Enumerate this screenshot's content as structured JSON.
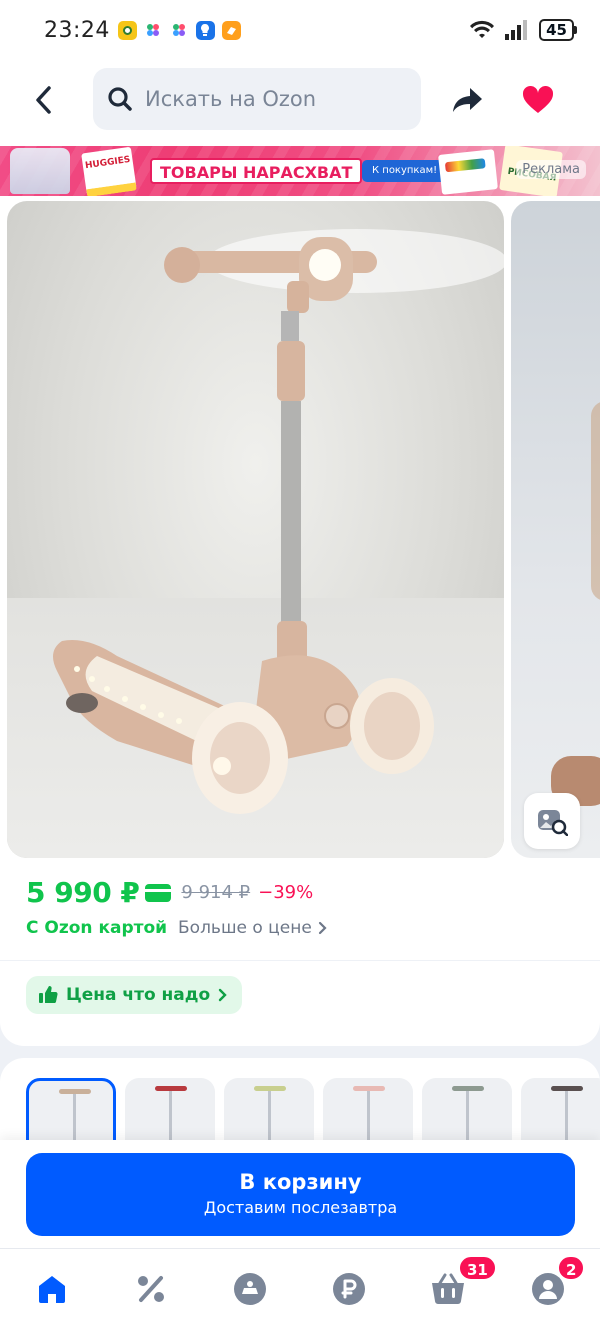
{
  "status_bar": {
    "time": "23:24",
    "battery": "45"
  },
  "header": {
    "search_placeholder": "Искать на Ozon"
  },
  "banner": {
    "headline": "ТОВАРЫ НАРАСХВАТ",
    "cta": "К покупкам!",
    "ad_label": "Реклама",
    "brand1": "HUGGIES",
    "brand2": "РИСОВАЯ"
  },
  "product": {
    "price": "5 990 ₽",
    "old_price": "9 914 ₽",
    "discount": "−39%",
    "ozon_card_label": "С Ozon картой",
    "more_price_label": "Больше о цене",
    "good_price_label": "Цена что надо"
  },
  "variants": [
    {
      "color": "#c9b09a"
    },
    {
      "color": "#b83a3e"
    },
    {
      "color": "#c8cf8e"
    },
    {
      "color": "#e8b9b3"
    },
    {
      "color": "#8d9a90"
    },
    {
      "color": "#5a5050"
    }
  ],
  "cart": {
    "label": "В корзину",
    "sublabel": "Доставим послезавтра"
  },
  "tabbar": {
    "cart_badge": "31",
    "profile_badge": "2"
  },
  "colors": {
    "accent": "#005bff",
    "price_green": "#10c44c",
    "discount_red": "#f91155",
    "favorite_pink": "#f91155"
  }
}
